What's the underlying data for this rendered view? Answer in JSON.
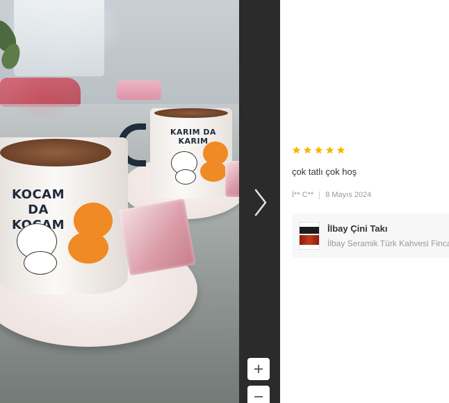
{
  "photo": {
    "back_cup_text": [
      "KARIM DA",
      "KARIM"
    ],
    "front_cup_text": [
      "KOCAM DA",
      "KOCAM"
    ]
  },
  "viewer": {
    "next_icon": "chevron-right-icon",
    "zoom_in_label": "+",
    "zoom_out_label": "−"
  },
  "review": {
    "rating": 5,
    "star_color": "#f5b700",
    "text": "çok tatlı çok hoş",
    "author": "İ** C**",
    "date": "8 Mayıs 2024"
  },
  "product": {
    "seller": "İlbay Çini Takı",
    "name": "İlbay Seramik Türk Kahvesi Fincanı"
  }
}
